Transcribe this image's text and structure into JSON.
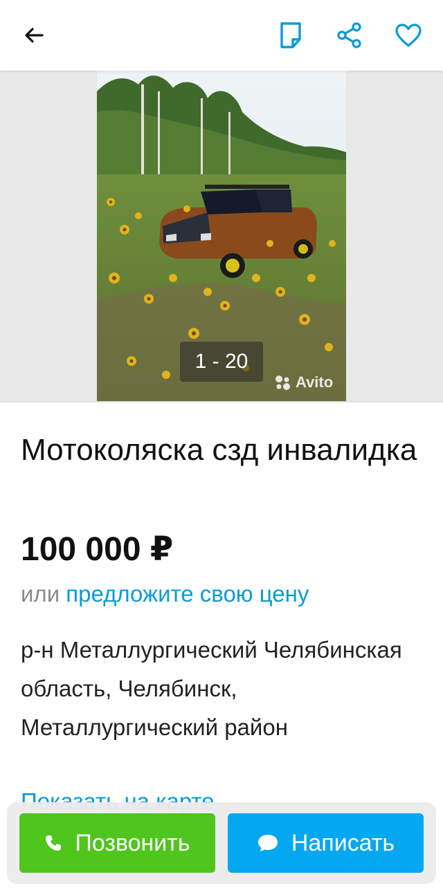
{
  "header": {
    "icons": [
      "back-arrow-icon",
      "note-icon",
      "share-icon",
      "heart-icon"
    ],
    "accent_color": "#0a9bd8"
  },
  "gallery": {
    "counter": "1 - 20",
    "watermark": "Avito"
  },
  "listing": {
    "title": "Мотоколяска сзд инвалидка",
    "price": "100 000 ₽",
    "offer_prefix": "или",
    "offer_link": "предложите свою цену",
    "address": "р-н Металлургический Челябинская область, Челябинск, Металлургический район",
    "map_link": "Показать на карте"
  },
  "actions": {
    "call_label": "Позвонить",
    "call_icon": "phone-icon",
    "call_color": "#50c51e",
    "message_label": "Написать",
    "message_icon": "chat-bubble-icon",
    "message_color": "#06a7f1"
  }
}
